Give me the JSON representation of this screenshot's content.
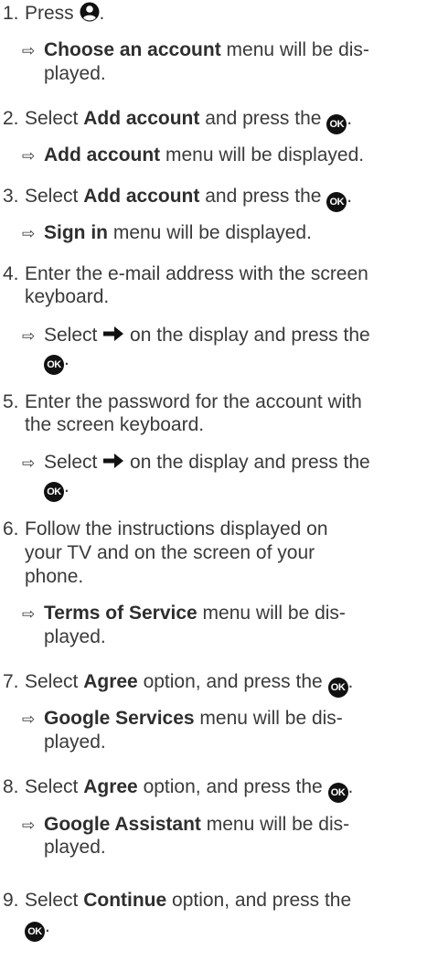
{
  "steps": [
    {
      "num": "1.",
      "pre": "Press ",
      "post": ".",
      "result": {
        "bold": "Choose an account",
        "text": " menu will be dis-",
        "cont": "played."
      }
    },
    {
      "num": "2.",
      "pre": "Select ",
      "bold": "Add account",
      "mid": " and press the ",
      "post": ".",
      "result": {
        "bold": "Add account",
        "text": " menu will be displayed."
      }
    },
    {
      "num": "3.",
      "pre": "Select ",
      "bold": "Add account",
      "mid": " and press the ",
      "post": ".",
      "result": {
        "bold": "Sign in",
        "text": " menu will be displayed."
      }
    },
    {
      "num": "4.",
      "text": "Enter the e-mail address with the screen",
      "cont": "keyboard.",
      "result": {
        "pre": "Select ",
        "mid": " on the display and press the",
        "post": "."
      }
    },
    {
      "num": "5.",
      "text": "Enter the password for the account with",
      "cont": "the screen keyboard.",
      "result": {
        "pre": "Select ",
        "mid": " on the display and press the",
        "post": "."
      }
    },
    {
      "num": "6.",
      "text": "Follow the instructions displayed on",
      "cont": "your TV and on the screen of your",
      "cont2": "phone.",
      "result": {
        "bold": "Terms of Service",
        "text": " menu will be dis-",
        "cont": "played."
      }
    },
    {
      "num": "7.",
      "pre": "Select ",
      "bold": "Agree",
      "mid": " option, and press the ",
      "post": ".",
      "result": {
        "bold": "Google Services",
        "text": " menu will be dis-",
        "cont": "played."
      }
    },
    {
      "num": "8.",
      "pre": "Select ",
      "bold": "Agree",
      "mid": " option, and press the ",
      "post": ".",
      "result": {
        "bold": "Google Assistant",
        "text": " menu will be dis-",
        "cont": "played."
      }
    },
    {
      "num": "9.",
      "pre": "Select ",
      "bold": "Continue",
      "mid": " option, and press the",
      "post": "."
    }
  ],
  "icons": {
    "result_arrow": "⇨",
    "ok_label": "OK",
    "account": "account-icon",
    "right_arrow": "right-arrow-icon"
  }
}
